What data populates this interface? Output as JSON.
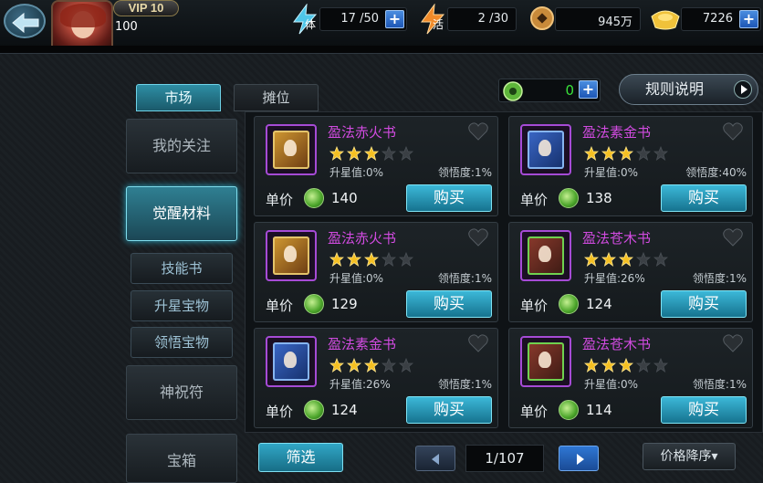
{
  "header": {
    "vip": "VIP 10",
    "level": "100",
    "stamina": {
      "label": "体",
      "value": "17 /50"
    },
    "vigor": {
      "label": "活",
      "value": "2 /30"
    },
    "coins": "945万",
    "gold": "7226",
    "plus": "+"
  },
  "tabs": [
    {
      "label": "市场"
    },
    {
      "label": "摊位"
    }
  ],
  "currency": {
    "value": "0",
    "plus": "+"
  },
  "rules_label": "规则说明",
  "sidebar": {
    "items": [
      {
        "label": "我的关注"
      },
      {
        "label": "觉醒材料"
      },
      {
        "label": "技能书"
      },
      {
        "label": "升星宝物"
      },
      {
        "label": "领悟宝物"
      },
      {
        "label": "神祝符"
      },
      {
        "label": "宝箱"
      }
    ]
  },
  "market": {
    "price_label": "单价",
    "buy_label": "购买",
    "items": [
      {
        "name": "盈法赤火书",
        "stars": 3,
        "max_stars": 5,
        "upgrade": "升星值:0%",
        "comprehension": "领悟度:1%",
        "price": "140",
        "cover": "fire"
      },
      {
        "name": "盈法素金书",
        "stars": 3,
        "max_stars": 5,
        "upgrade": "升星值:0%",
        "comprehension": "领悟度:40%",
        "price": "138",
        "cover": "gold"
      },
      {
        "name": "盈法赤火书",
        "stars": 3,
        "max_stars": 5,
        "upgrade": "升星值:0%",
        "comprehension": "领悟度:1%",
        "price": "129",
        "cover": "fire"
      },
      {
        "name": "盈法苍木书",
        "stars": 3,
        "max_stars": 5,
        "upgrade": "升星值:26%",
        "comprehension": "领悟度:1%",
        "price": "124",
        "cover": "wood"
      },
      {
        "name": "盈法素金书",
        "stars": 3,
        "max_stars": 5,
        "upgrade": "升星值:26%",
        "comprehension": "领悟度:1%",
        "price": "124",
        "cover": "gold"
      },
      {
        "name": "盈法苍木书",
        "stars": 3,
        "max_stars": 5,
        "upgrade": "升星值:0%",
        "comprehension": "领悟度:1%",
        "price": "114",
        "cover": "wood"
      }
    ]
  },
  "footer": {
    "filter_label": "筛选",
    "page": "1/107",
    "sort_label": "价格降序▾"
  },
  "colors": {
    "item_name": "#d14be0",
    "accent": "#3cb8d8",
    "currency_value": "#39e23a"
  },
  "icons": {
    "back": "back-arrow-icon",
    "stamina": "lightning-icon",
    "vigor": "flame-lightning-icon",
    "coin": "copper-coin-icon",
    "gold": "gold-ingot-icon",
    "jade": "jade-coin-icon",
    "favorite": "heart-icon",
    "star": "star-icon"
  }
}
